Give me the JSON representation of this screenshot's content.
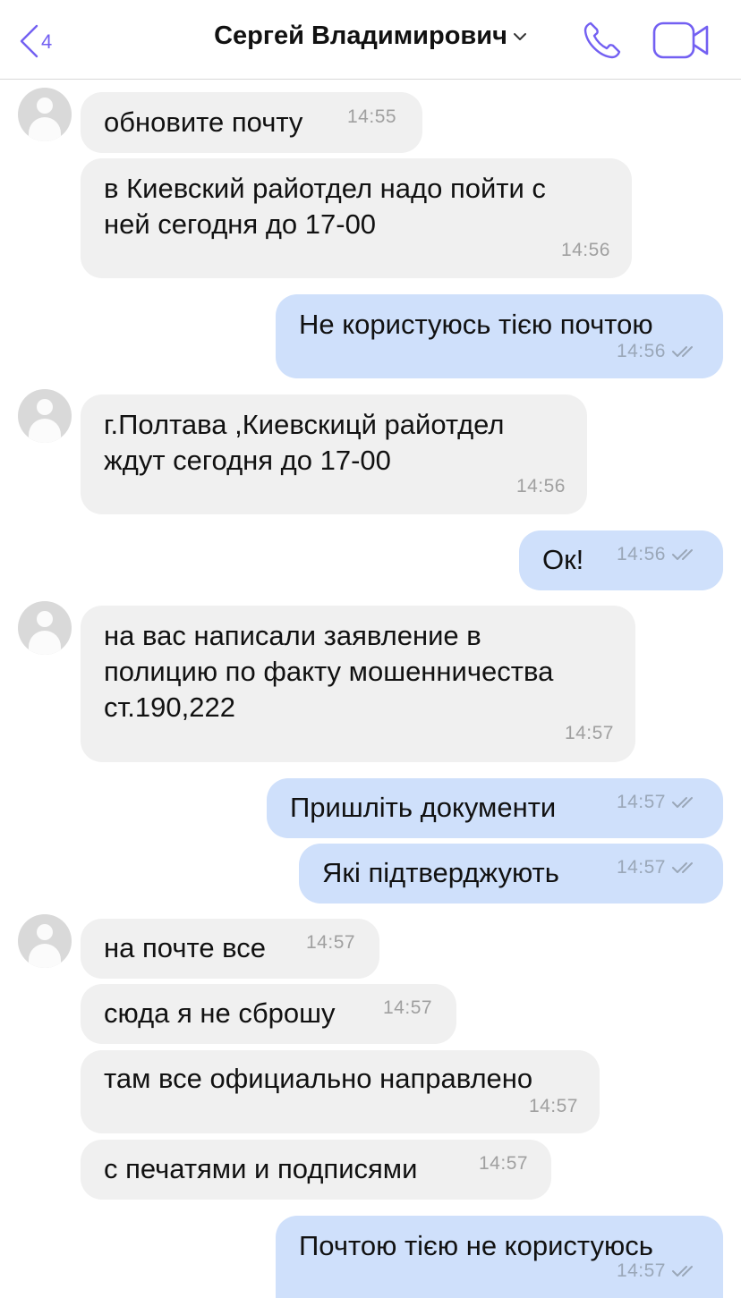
{
  "header": {
    "back_count": "4",
    "contact_name": "Сергей Владимирович"
  },
  "messages": [
    {
      "dir": "in",
      "text": "обновите почту",
      "time": "14:55"
    },
    {
      "dir": "in",
      "text": "в Киевский райотдел надо пойти с\nней сегодня до 17-00",
      "time": "14:56"
    },
    {
      "dir": "out",
      "text": "Не користуюсь тією почтою",
      "time": "14:56"
    },
    {
      "dir": "in",
      "text": "г.Полтава ,Киевскицй райотдел\nждут сегодня до 17-00",
      "time": "14:56"
    },
    {
      "dir": "out",
      "text": "Ок!",
      "time": "14:56"
    },
    {
      "dir": "in",
      "text": "на вас написали заявление в\nполицию по факту мошенничества\nст.190,222",
      "time": "14:57"
    },
    {
      "dir": "out",
      "text": "Пришліть документи",
      "time": "14:57"
    },
    {
      "dir": "out",
      "text": "Які підтверджують",
      "time": "14:57"
    },
    {
      "dir": "in",
      "text": "на почте все",
      "time": "14:57"
    },
    {
      "dir": "in",
      "text": "сюда я не сброшу",
      "time": "14:57"
    },
    {
      "dir": "in",
      "text": "там все официально направлено",
      "time": "14:57"
    },
    {
      "dir": "in",
      "text": "с печатями и подписями",
      "time": "14:57"
    },
    {
      "dir": "out",
      "text": "Почтою тією не користуюсь",
      "time": "14:57"
    }
  ],
  "colors": {
    "accent": "#7360f2",
    "incoming_bubble": "#f0f0f0",
    "outgoing_bubble": "#cfe0fb"
  }
}
